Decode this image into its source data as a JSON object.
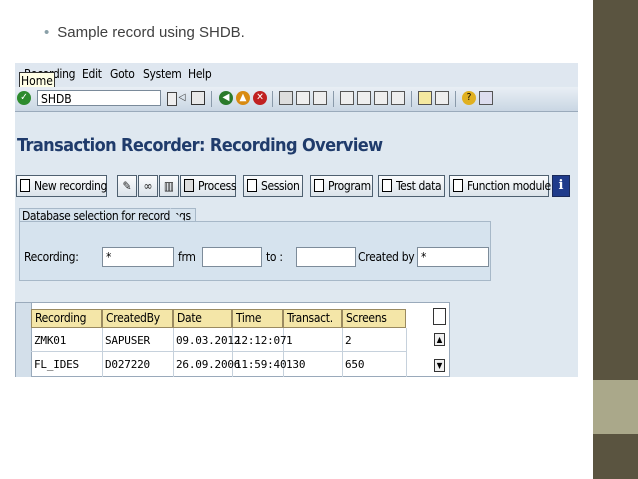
{
  "slide": {
    "bullet_text": "Sample record using SHDB."
  },
  "colors": {
    "title": "#1f3b6b",
    "strip": "#5a5440",
    "strip_block": "#aaa88a",
    "header_cells": "#f4e6a8",
    "sap_bg": "#dfe8f0"
  },
  "sap": {
    "menu": {
      "items": [
        "Recording",
        "Edit",
        "Goto",
        "System",
        "Help"
      ],
      "tooltip": "Home"
    },
    "toolbar": {
      "command_field_value": "SHDB",
      "icons": [
        "enter-icon",
        "back-icon",
        "exit-icon",
        "cancel-icon",
        "print-icon",
        "find-icon",
        "first-page-icon",
        "prev-page-icon",
        "next-page-icon",
        "last-page-icon",
        "new-session-icon",
        "shortcut-icon",
        "help-icon",
        "layout-icon"
      ]
    },
    "screen_title": "Transaction Recorder: Recording Overview",
    "app_toolbar": {
      "new_recording": "New recording",
      "process": "Process",
      "session": "Session",
      "program": "Program",
      "test_data": "Test data",
      "function_module": "Function module",
      "info": "i"
    },
    "selection": {
      "group_title": "Database selection for recordings",
      "recording_label": "Recording:",
      "recording_value": "*",
      "frm_label": "frm",
      "to_label": "to :",
      "created_by_label": "Created by",
      "created_by_value": "*"
    },
    "table": {
      "columns": [
        "Recording",
        "CreatedBy",
        "Date",
        "Time",
        "Transact.",
        "Screens"
      ],
      "rows": [
        [
          "ZMK01",
          "SAPUSER",
          "09.03.2012",
          "12:12:07",
          "1",
          "2"
        ],
        [
          "FL_IDES",
          "D027220",
          "26.09.2006",
          "11:59:40",
          "130",
          "650"
        ]
      ]
    }
  }
}
